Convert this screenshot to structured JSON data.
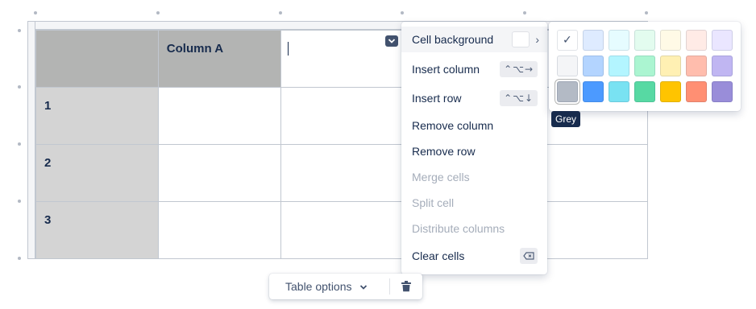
{
  "table": {
    "header": {
      "col_a": "Column A"
    },
    "rows": [
      {
        "label": "1"
      },
      {
        "label": "2"
      },
      {
        "label": "3"
      }
    ]
  },
  "context_menu": {
    "items": [
      {
        "label": "Cell background",
        "type": "submenu"
      },
      {
        "label": "Insert column",
        "shortcut": "⌃⌥→"
      },
      {
        "label": "Insert row",
        "shortcut": "⌃⌥↓"
      },
      {
        "label": "Remove column"
      },
      {
        "label": "Remove row"
      },
      {
        "label": "Merge cells",
        "disabled": true
      },
      {
        "label": "Split cell",
        "disabled": true
      },
      {
        "label": "Distribute columns",
        "disabled": true
      },
      {
        "label": "Clear cells",
        "shortcut_icon": "backspace-icon"
      }
    ]
  },
  "palette": {
    "colors": [
      [
        "#ffffff",
        "#deebff",
        "#e6fcff",
        "#e3fcef",
        "#fffae6",
        "#ffebe6",
        "#eae6ff"
      ],
      [
        "#f4f5f7",
        "#b3d4ff",
        "#b3f5ff",
        "#abf5d1",
        "#fff0b3",
        "#ffbdad",
        "#c0b6f2"
      ],
      [
        "#b3bac5",
        "#4c9aff",
        "#79e2f2",
        "#57d9a3",
        "#ffc400",
        "#ff8f73",
        "#998dd9"
      ]
    ],
    "selected": "#ffffff",
    "hovered": "#b3bac5",
    "tooltip": "Grey"
  },
  "toolbar": {
    "table_options_label": "Table options"
  }
}
